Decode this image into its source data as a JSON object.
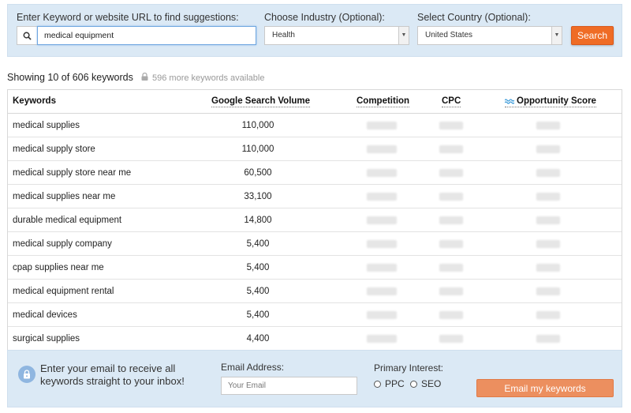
{
  "search": {
    "keyword_label": "Enter Keyword or website URL to find suggestions:",
    "keyword_value": "medical equipment",
    "industry_label": "Choose Industry (Optional):",
    "industry_value": "Health",
    "country_label": "Select Country (Optional):",
    "country_value": "United States",
    "search_button": "Search",
    "search_button_color": "#ef6c25"
  },
  "summary": {
    "showing": "Showing 10 of 606 keywords",
    "more": "596 more keywords available"
  },
  "table": {
    "headers": {
      "keywords": "Keywords",
      "volume": "Google Search Volume",
      "competition": "Competition",
      "cpc": "CPC",
      "opportunity": "Opportunity Score"
    },
    "rows": [
      {
        "keyword": "medical supplies",
        "volume": "110,000"
      },
      {
        "keyword": "medical supply store",
        "volume": "110,000"
      },
      {
        "keyword": "medical supply store near me",
        "volume": "60,500"
      },
      {
        "keyword": "medical supplies near me",
        "volume": "33,100"
      },
      {
        "keyword": "durable medical equipment",
        "volume": "14,800"
      },
      {
        "keyword": "medical supply company",
        "volume": "5,400"
      },
      {
        "keyword": "cpap supplies near me",
        "volume": "5,400"
      },
      {
        "keyword": "medical equipment rental",
        "volume": "5,400"
      },
      {
        "keyword": "medical devices",
        "volume": "5,400"
      },
      {
        "keyword": "surgical supplies",
        "volume": "4,400"
      }
    ]
  },
  "email_panel": {
    "promo": "Enter your email to receive all keywords straight to your inbox!",
    "email_label": "Email Address:",
    "email_placeholder": "Your Email",
    "interest_label": "Primary Interest:",
    "option_ppc": "PPC",
    "option_seo": "SEO",
    "submit_button": "Email my keywords",
    "submit_button_color": "#ec8f5f"
  },
  "colors": {
    "panel_bg": "#dbe9f5",
    "accent": "#ef6c25"
  },
  "icons": [
    "search-icon",
    "chevron-down-icon",
    "lock-icon",
    "wave-icon"
  ]
}
